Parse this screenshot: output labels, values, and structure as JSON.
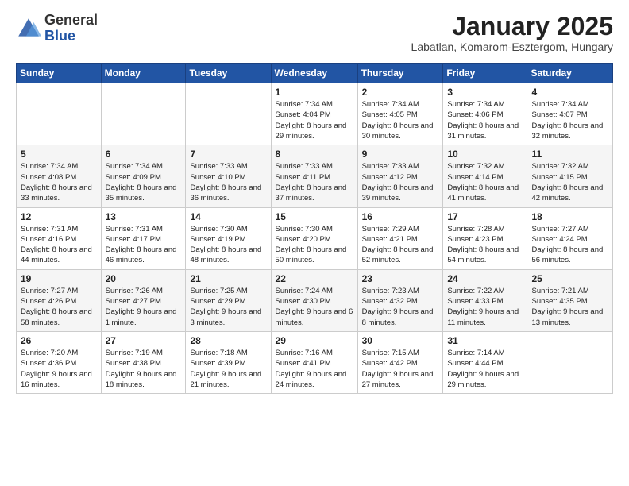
{
  "logo": {
    "general": "General",
    "blue": "Blue"
  },
  "header": {
    "month": "January 2025",
    "location": "Labatlan, Komarom-Esztergom, Hungary"
  },
  "days_of_week": [
    "Sunday",
    "Monday",
    "Tuesday",
    "Wednesday",
    "Thursday",
    "Friday",
    "Saturday"
  ],
  "weeks": [
    [
      {
        "day": "",
        "info": ""
      },
      {
        "day": "",
        "info": ""
      },
      {
        "day": "",
        "info": ""
      },
      {
        "day": "1",
        "info": "Sunrise: 7:34 AM\nSunset: 4:04 PM\nDaylight: 8 hours and 29 minutes."
      },
      {
        "day": "2",
        "info": "Sunrise: 7:34 AM\nSunset: 4:05 PM\nDaylight: 8 hours and 30 minutes."
      },
      {
        "day": "3",
        "info": "Sunrise: 7:34 AM\nSunset: 4:06 PM\nDaylight: 8 hours and 31 minutes."
      },
      {
        "day": "4",
        "info": "Sunrise: 7:34 AM\nSunset: 4:07 PM\nDaylight: 8 hours and 32 minutes."
      }
    ],
    [
      {
        "day": "5",
        "info": "Sunrise: 7:34 AM\nSunset: 4:08 PM\nDaylight: 8 hours and 33 minutes."
      },
      {
        "day": "6",
        "info": "Sunrise: 7:34 AM\nSunset: 4:09 PM\nDaylight: 8 hours and 35 minutes."
      },
      {
        "day": "7",
        "info": "Sunrise: 7:33 AM\nSunset: 4:10 PM\nDaylight: 8 hours and 36 minutes."
      },
      {
        "day": "8",
        "info": "Sunrise: 7:33 AM\nSunset: 4:11 PM\nDaylight: 8 hours and 37 minutes."
      },
      {
        "day": "9",
        "info": "Sunrise: 7:33 AM\nSunset: 4:12 PM\nDaylight: 8 hours and 39 minutes."
      },
      {
        "day": "10",
        "info": "Sunrise: 7:32 AM\nSunset: 4:14 PM\nDaylight: 8 hours and 41 minutes."
      },
      {
        "day": "11",
        "info": "Sunrise: 7:32 AM\nSunset: 4:15 PM\nDaylight: 8 hours and 42 minutes."
      }
    ],
    [
      {
        "day": "12",
        "info": "Sunrise: 7:31 AM\nSunset: 4:16 PM\nDaylight: 8 hours and 44 minutes."
      },
      {
        "day": "13",
        "info": "Sunrise: 7:31 AM\nSunset: 4:17 PM\nDaylight: 8 hours and 46 minutes."
      },
      {
        "day": "14",
        "info": "Sunrise: 7:30 AM\nSunset: 4:19 PM\nDaylight: 8 hours and 48 minutes."
      },
      {
        "day": "15",
        "info": "Sunrise: 7:30 AM\nSunset: 4:20 PM\nDaylight: 8 hours and 50 minutes."
      },
      {
        "day": "16",
        "info": "Sunrise: 7:29 AM\nSunset: 4:21 PM\nDaylight: 8 hours and 52 minutes."
      },
      {
        "day": "17",
        "info": "Sunrise: 7:28 AM\nSunset: 4:23 PM\nDaylight: 8 hours and 54 minutes."
      },
      {
        "day": "18",
        "info": "Sunrise: 7:27 AM\nSunset: 4:24 PM\nDaylight: 8 hours and 56 minutes."
      }
    ],
    [
      {
        "day": "19",
        "info": "Sunrise: 7:27 AM\nSunset: 4:26 PM\nDaylight: 8 hours and 58 minutes."
      },
      {
        "day": "20",
        "info": "Sunrise: 7:26 AM\nSunset: 4:27 PM\nDaylight: 9 hours and 1 minute."
      },
      {
        "day": "21",
        "info": "Sunrise: 7:25 AM\nSunset: 4:29 PM\nDaylight: 9 hours and 3 minutes."
      },
      {
        "day": "22",
        "info": "Sunrise: 7:24 AM\nSunset: 4:30 PM\nDaylight: 9 hours and 6 minutes."
      },
      {
        "day": "23",
        "info": "Sunrise: 7:23 AM\nSunset: 4:32 PM\nDaylight: 9 hours and 8 minutes."
      },
      {
        "day": "24",
        "info": "Sunrise: 7:22 AM\nSunset: 4:33 PM\nDaylight: 9 hours and 11 minutes."
      },
      {
        "day": "25",
        "info": "Sunrise: 7:21 AM\nSunset: 4:35 PM\nDaylight: 9 hours and 13 minutes."
      }
    ],
    [
      {
        "day": "26",
        "info": "Sunrise: 7:20 AM\nSunset: 4:36 PM\nDaylight: 9 hours and 16 minutes."
      },
      {
        "day": "27",
        "info": "Sunrise: 7:19 AM\nSunset: 4:38 PM\nDaylight: 9 hours and 18 minutes."
      },
      {
        "day": "28",
        "info": "Sunrise: 7:18 AM\nSunset: 4:39 PM\nDaylight: 9 hours and 21 minutes."
      },
      {
        "day": "29",
        "info": "Sunrise: 7:16 AM\nSunset: 4:41 PM\nDaylight: 9 hours and 24 minutes."
      },
      {
        "day": "30",
        "info": "Sunrise: 7:15 AM\nSunset: 4:42 PM\nDaylight: 9 hours and 27 minutes."
      },
      {
        "day": "31",
        "info": "Sunrise: 7:14 AM\nSunset: 4:44 PM\nDaylight: 9 hours and 29 minutes."
      },
      {
        "day": "",
        "info": ""
      }
    ]
  ]
}
